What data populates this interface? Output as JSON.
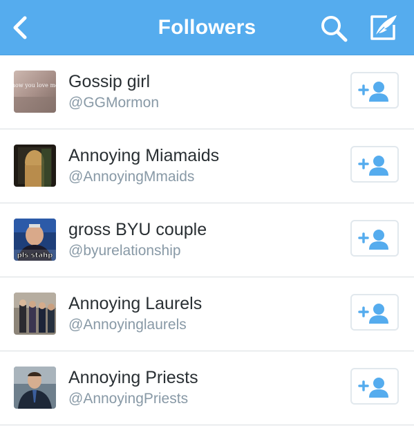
{
  "header": {
    "title": "Followers",
    "back_icon": "chevron-left-icon",
    "search_icon": "search-icon",
    "compose_icon": "compose-tweet-icon",
    "background": "#55acee"
  },
  "followers": [
    {
      "name": "Gossip girl",
      "handle": "@GGMormon",
      "avatar_text": "you know you love me xoxo"
    },
    {
      "name": "Annoying Miamaids",
      "handle": "@AnnoyingMmaids"
    },
    {
      "name": "gross BYU couple",
      "handle": "@byurelationship",
      "avatar_text": "pls stahp"
    },
    {
      "name": "Annoying Laurels",
      "handle": "@Annoyinglaurels"
    },
    {
      "name": "Annoying Priests",
      "handle": "@AnnoyingPriests"
    }
  ],
  "follow_button_icon": "add-user-icon",
  "colors": {
    "accent": "#55acee",
    "name_text": "#292f33",
    "handle_text": "#8899a6"
  }
}
